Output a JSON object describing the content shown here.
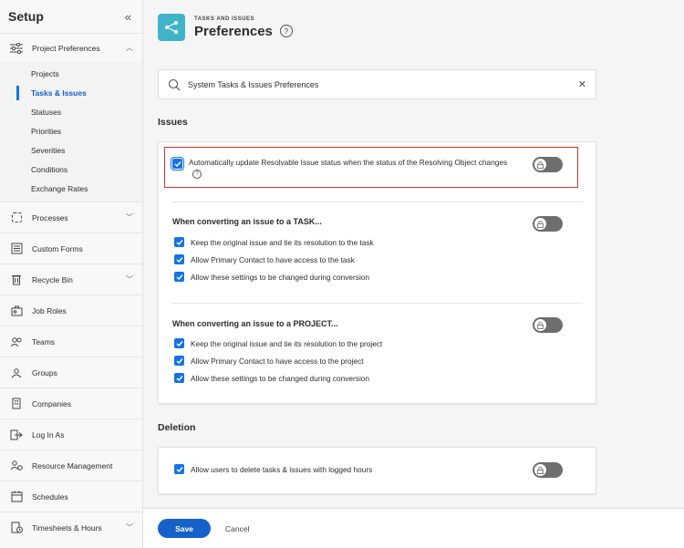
{
  "sidebar": {
    "title": "Setup",
    "collapse_icon": "double-chevron-left-icon",
    "project_preferences": {
      "label": "Project Preferences",
      "icon": "sliders-icon",
      "items": [
        "Projects",
        "Tasks & Issues",
        "Statuses",
        "Priorities",
        "Severities",
        "Conditions",
        "Exchange Rates"
      ],
      "active_index": 1
    },
    "items": [
      {
        "label": "Processes",
        "icon": "process-icon",
        "has_chevron": true
      },
      {
        "label": "Custom Forms",
        "icon": "form-icon",
        "has_chevron": false
      },
      {
        "label": "Recycle Bin",
        "icon": "trash-icon",
        "has_chevron": true
      },
      {
        "label": "Job Roles",
        "icon": "job-role-icon",
        "has_chevron": false
      },
      {
        "label": "Teams",
        "icon": "teams-icon",
        "has_chevron": false
      },
      {
        "label": "Groups",
        "icon": "groups-icon",
        "has_chevron": false
      },
      {
        "label": "Companies",
        "icon": "company-icon",
        "has_chevron": false
      },
      {
        "label": "Log In As",
        "icon": "login-icon",
        "has_chevron": false
      },
      {
        "label": "Resource Management",
        "icon": "resource-icon",
        "has_chevron": false
      },
      {
        "label": "Schedules",
        "icon": "calendar-icon",
        "has_chevron": false
      },
      {
        "label": "Timesheets & Hours",
        "icon": "timesheet-icon",
        "has_chevron": true
      }
    ]
  },
  "header": {
    "eyebrow": "TASKS AND ISSUES",
    "title": "Preferences",
    "help": "?"
  },
  "search": {
    "value": "System Tasks & Issues Preferences",
    "clear": "✕"
  },
  "issues": {
    "title": "Issues",
    "auto_update": {
      "label": "Automatically update Resolvable Issue status when the status of the Resolving Object changes",
      "help": "?",
      "checked": true
    },
    "task": {
      "heading": "When converting an issue to a TASK...",
      "options": [
        "Keep the original issue and tie its resolution to the task",
        "Allow Primary Contact to have access to the task",
        "Allow these settings to be changed during conversion"
      ]
    },
    "project": {
      "heading": "When converting an issue to a PROJECT...",
      "options": [
        "Keep the original issue and tie its resolution to the project",
        "Allow Primary Contact to have access to the project",
        "Allow these settings to be changed during conversion"
      ]
    }
  },
  "deletion": {
    "title": "Deletion",
    "option": "Allow users to delete tasks & issues with logged hours"
  },
  "footer": {
    "save": "Save",
    "cancel": "Cancel"
  },
  "colors": {
    "accent": "#1473e6",
    "save_button": "#1461c9",
    "app_icon": "#3fb4c8",
    "highlight": "#d6322a",
    "toggle_locked": "#6e6e6e"
  }
}
